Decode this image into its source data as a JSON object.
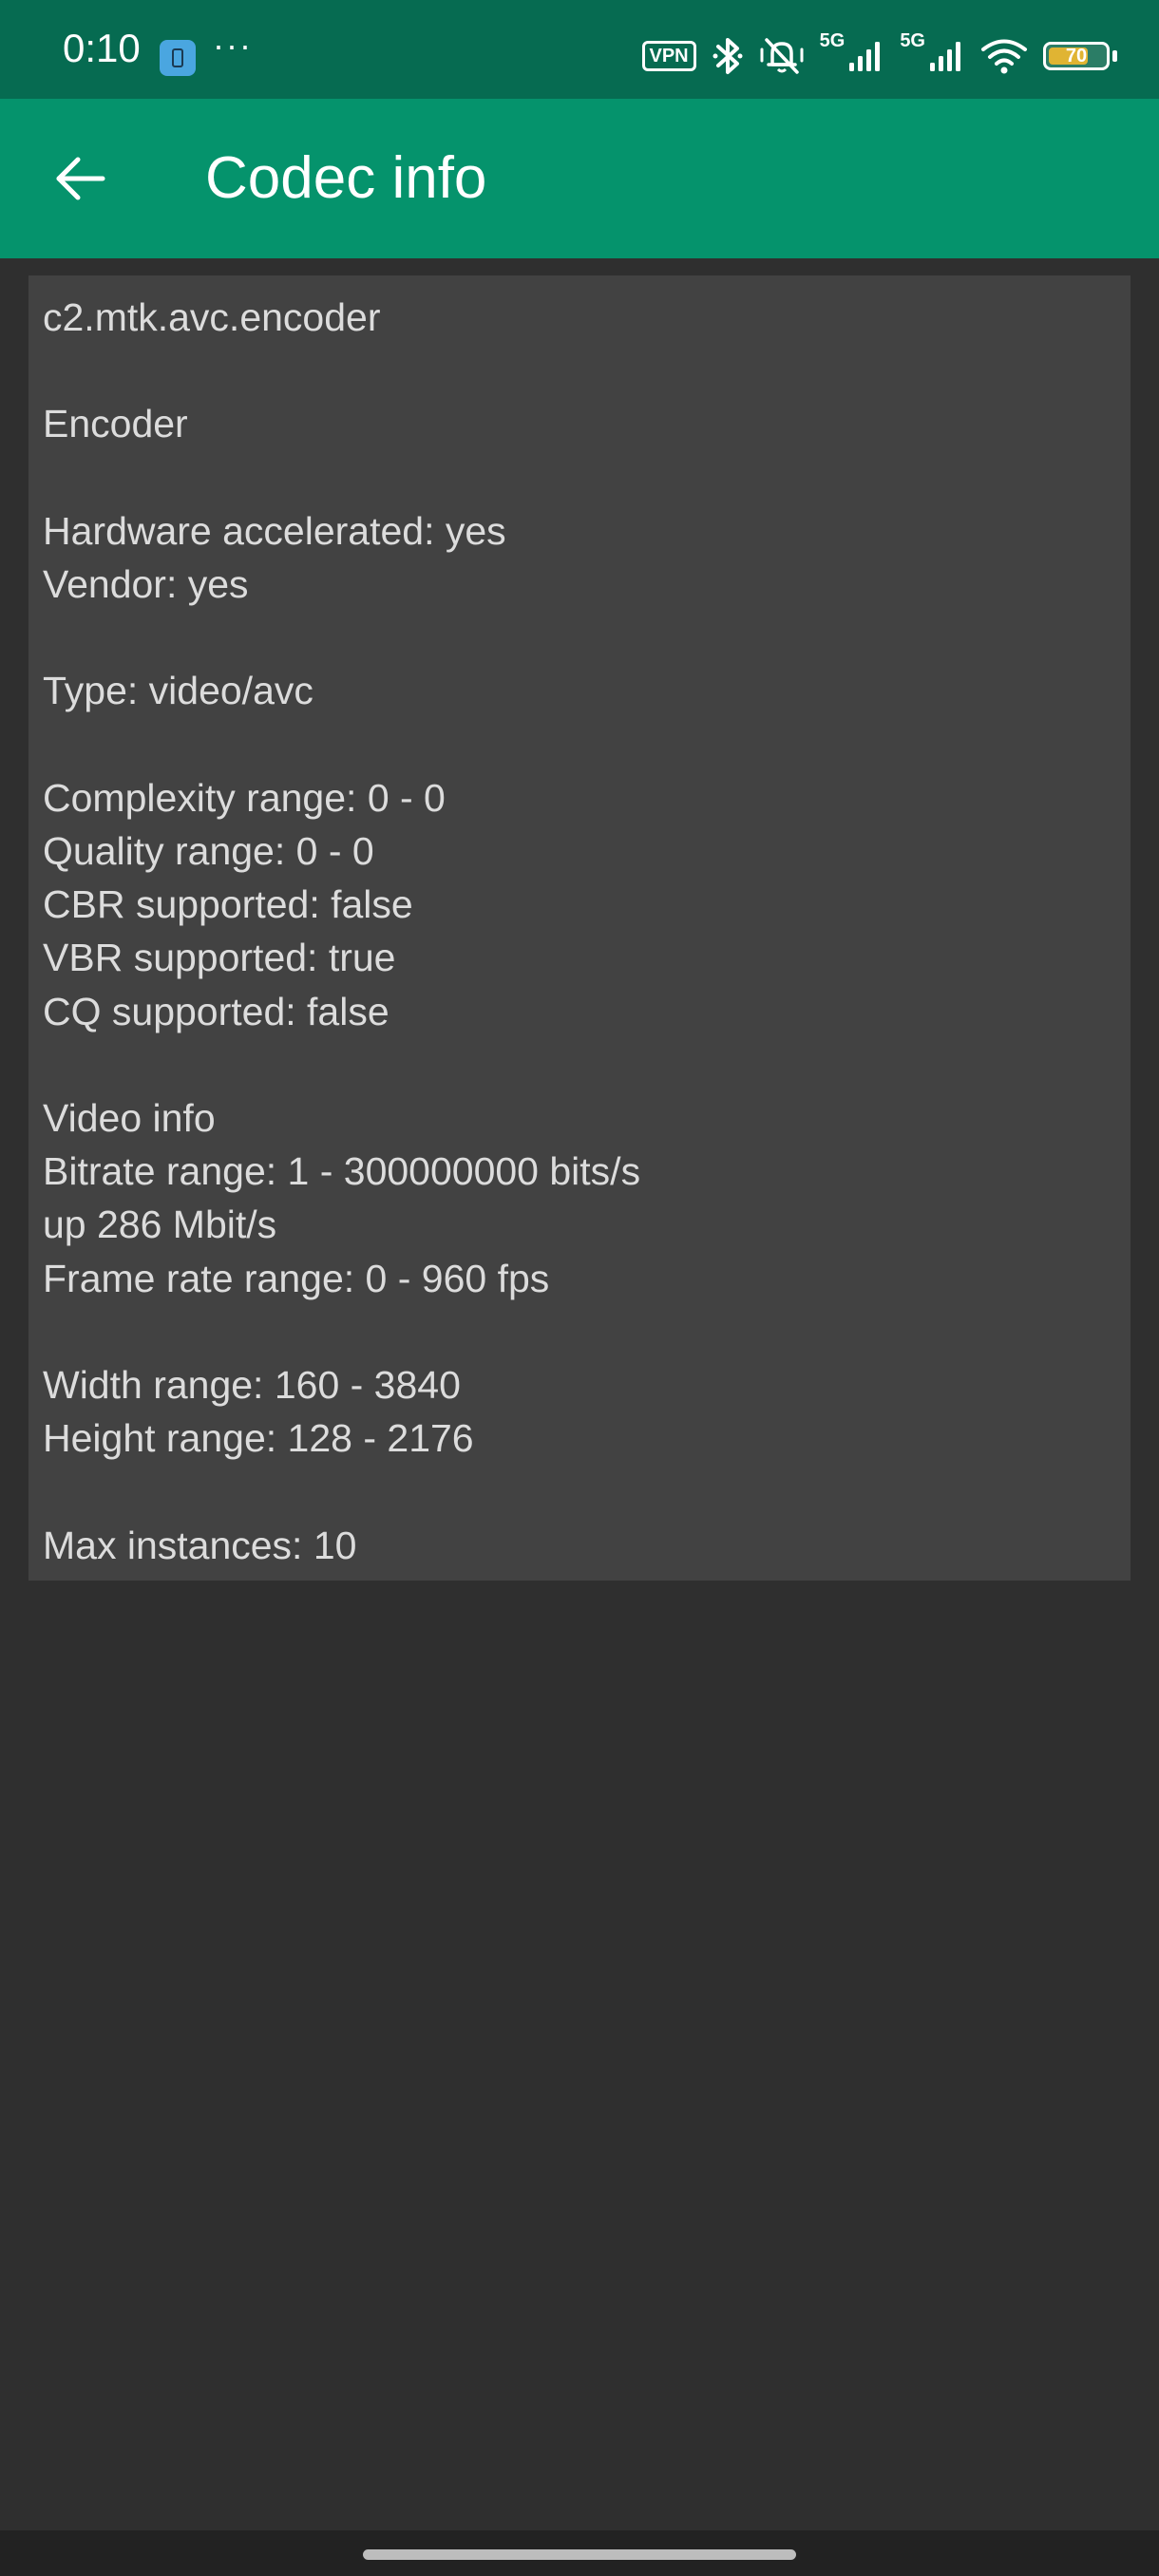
{
  "status_bar": {
    "time": "0:10",
    "more": "···",
    "vpn": "VPN",
    "sim1_label": "5G",
    "sim2_label": "5G",
    "battery_level": 70,
    "battery_text": "70"
  },
  "app_bar": {
    "title": "Codec info"
  },
  "codec": {
    "name": "c2.mtk.avc.encoder",
    "kind": "Encoder",
    "hardware_accelerated": "Hardware accelerated: yes",
    "vendor": "Vendor: yes",
    "type": "Type: video/avc",
    "complexity_range": "Complexity range: 0 - 0",
    "quality_range": "Quality range: 0 - 0",
    "cbr_supported": "CBR supported: false",
    "vbr_supported": "VBR supported: true",
    "cq_supported": "CQ supported: false",
    "video_info_heading": "Video info",
    "bitrate_range": "Bitrate range: 1 - 300000000 bits/s",
    "bitrate_up": "up 286 Mbit/s",
    "frame_rate_range": "Frame rate range: 0 - 960 fps",
    "width_range": "Width range: 160 - 3840",
    "height_range": "Height range: 128 - 2176",
    "max_instances": "Max instances: 10"
  },
  "colors": {
    "status_bar": "#066b51",
    "app_bar": "#05936c",
    "background": "#2f2f2f",
    "card": "#424242",
    "text": "#dcdcdc",
    "battery": "#e0b433"
  },
  "icons": {
    "back": "arrow-left-icon",
    "bluetooth": "bluetooth-icon",
    "mute": "vibrate-mute-icon",
    "signal": "cell-signal-icon",
    "wifi": "wifi-icon",
    "battery": "battery-icon"
  }
}
